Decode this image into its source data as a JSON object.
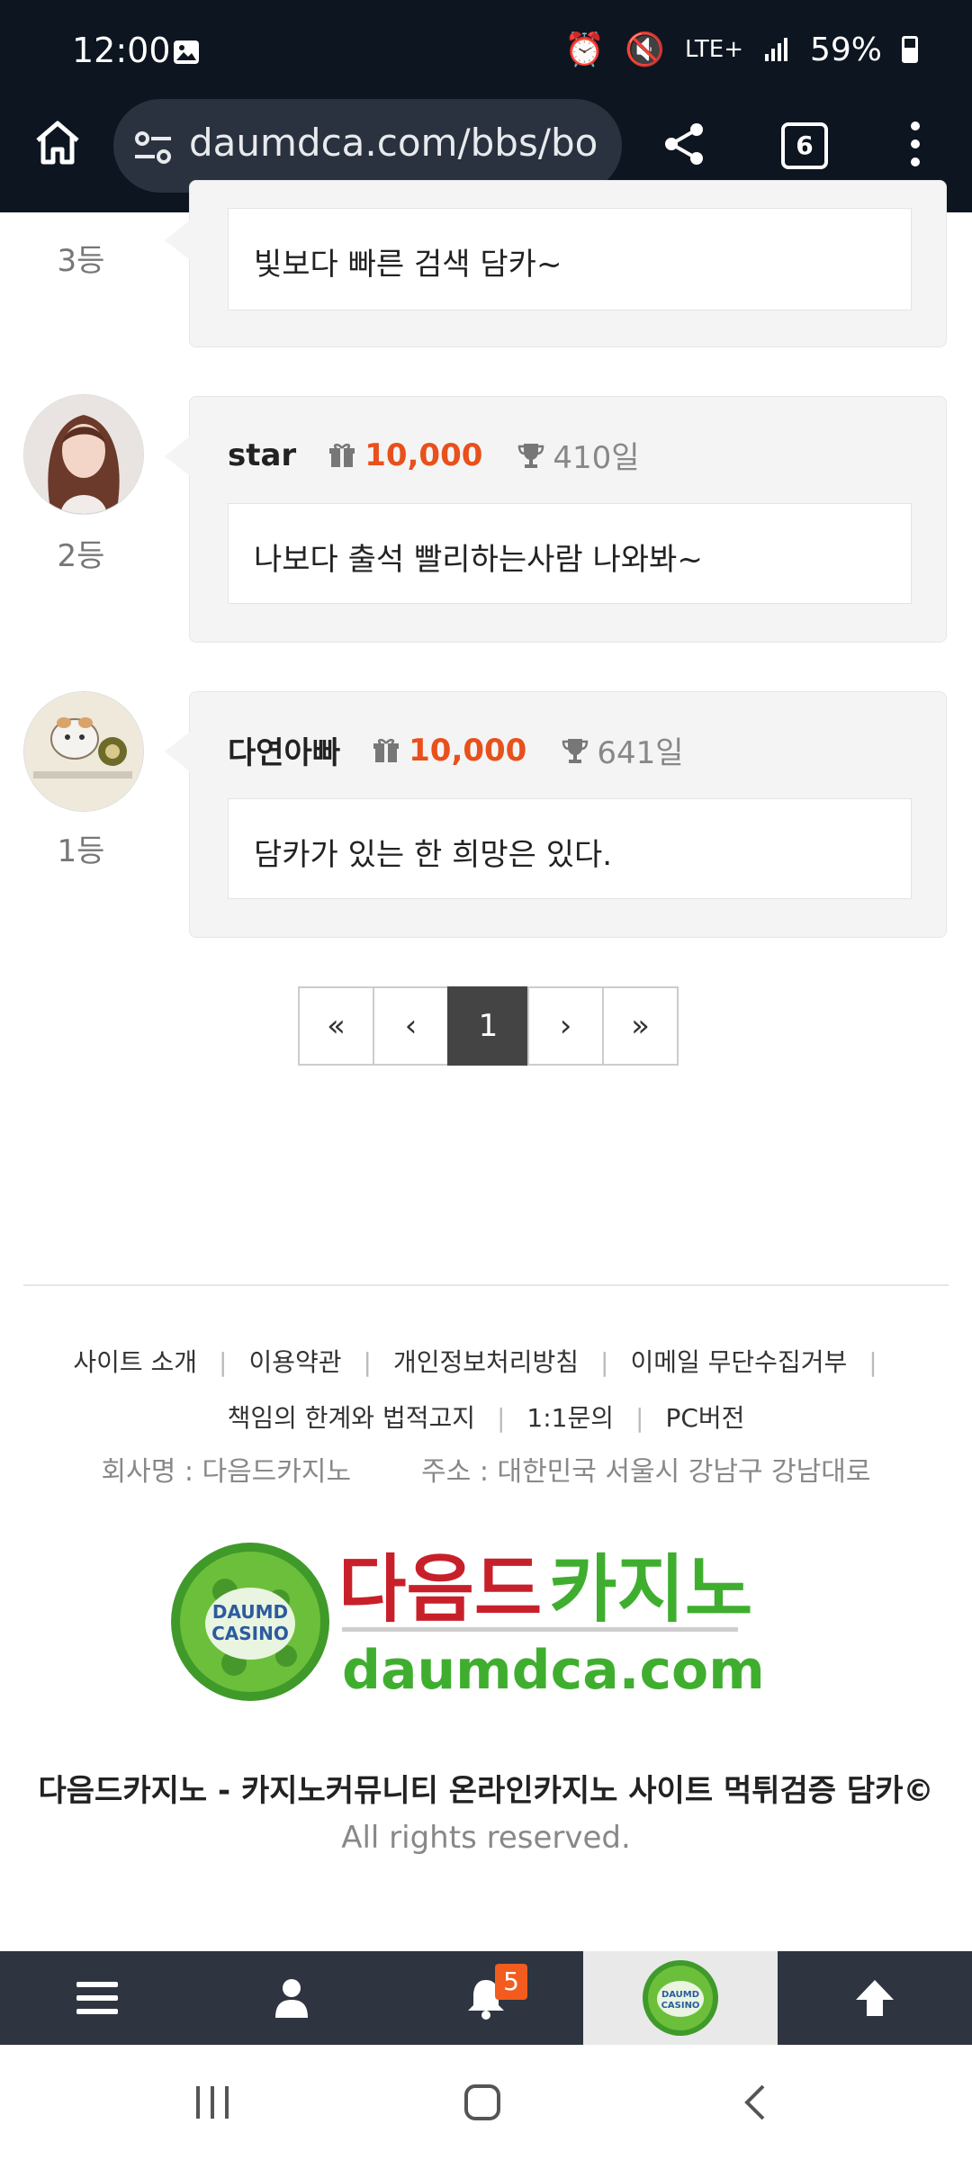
{
  "status_bar": {
    "time": "12:00",
    "network": "LTE+",
    "battery": "59%"
  },
  "browser": {
    "url": "daumdca.com/bbs/bo",
    "tab_count": "6"
  },
  "comments": [
    {
      "rank": "3등",
      "message": "빛보다 빠른 검색 담카~"
    },
    {
      "rank": "2등",
      "nickname": "star",
      "points": "10,000",
      "days": "410일",
      "message": "나보다 출석 빨리하는사람 나와봐~"
    },
    {
      "rank": "1등",
      "nickname": "다연아빠",
      "points": "10,000",
      "days": "641일",
      "message": "담카가 있는 한 희망은 있다."
    }
  ],
  "pagination": {
    "first": "«",
    "prev": "‹",
    "current": "1",
    "next": "›",
    "last": "»"
  },
  "footer": {
    "links_row1": [
      "사이트 소개",
      "이용약관",
      "개인정보처리방침",
      "이메일 무단수집거부"
    ],
    "links_row2": [
      "책임의 한계와 법적고지",
      "1:1문의",
      "PC버전"
    ],
    "company": "회사명 : 다음드카지노",
    "address": "주소 : 대한민국 서울시 강남구 강남대로",
    "logo_text_kr_red": "다음드",
    "logo_text_kr_green": "카지노",
    "logo_domain": "daumdca.com",
    "logo_badge_line1": "DAUMD",
    "logo_badge_line2": "CASINO",
    "copyright": "다음드카지노 - 카지노커뮤니티 온라인카지노 사이트 먹튀검증 담카©",
    "rights": "All rights reserved."
  },
  "bottom_nav": {
    "notification_count": "5"
  },
  "colors": {
    "points": "#e8501c",
    "top_bar": "#0d1520",
    "bottom_nav": "#2e3440",
    "badge": "#f25c1e"
  }
}
